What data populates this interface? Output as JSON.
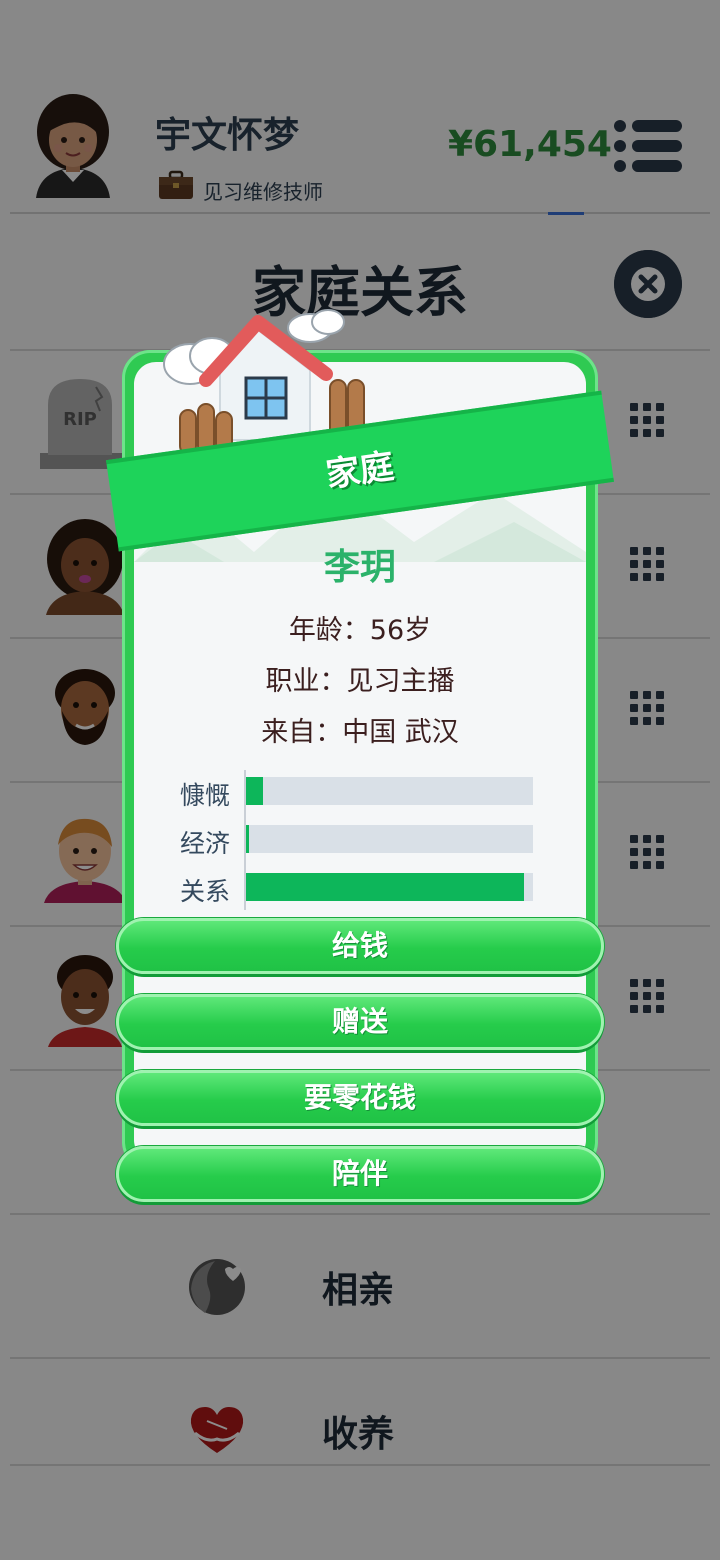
{
  "header": {
    "player_name": "宇文怀梦",
    "player_job": "见习维修技师",
    "money": "¥61,454"
  },
  "page": {
    "title": "家庭关系"
  },
  "relatives": [
    {
      "icon": "rip-tombstone-icon",
      "rip_text": "RIP"
    },
    {
      "icon": "woman-avatar-icon"
    },
    {
      "icon": "bearded-man-avatar-icon"
    },
    {
      "icon": "young-man-avatar-icon"
    },
    {
      "icon": "boy-avatar-icon"
    }
  ],
  "options": [
    {
      "label": "相亲",
      "icon": "dating-icon"
    },
    {
      "label": "收养",
      "icon": "adopt-heart-icon"
    }
  ],
  "dialog": {
    "banner": "家庭",
    "person_name": "李玥",
    "age_line": "年龄：56岁",
    "job_line": "职业：见习主播",
    "origin_line": "来自：中国 武汉",
    "stats": [
      {
        "label": "慷慨",
        "value": 0.06
      },
      {
        "label": "经济",
        "value": 0.01
      },
      {
        "label": "关系",
        "value": 0.97
      }
    ],
    "buttons": [
      "给钱",
      "赠送",
      "要零花钱",
      "陪伴"
    ]
  },
  "colors": {
    "money": "#2e8b3d",
    "dialog_green": "#2fca52",
    "name_green": "#2bb26a",
    "bar_fill": "#0db65a"
  }
}
